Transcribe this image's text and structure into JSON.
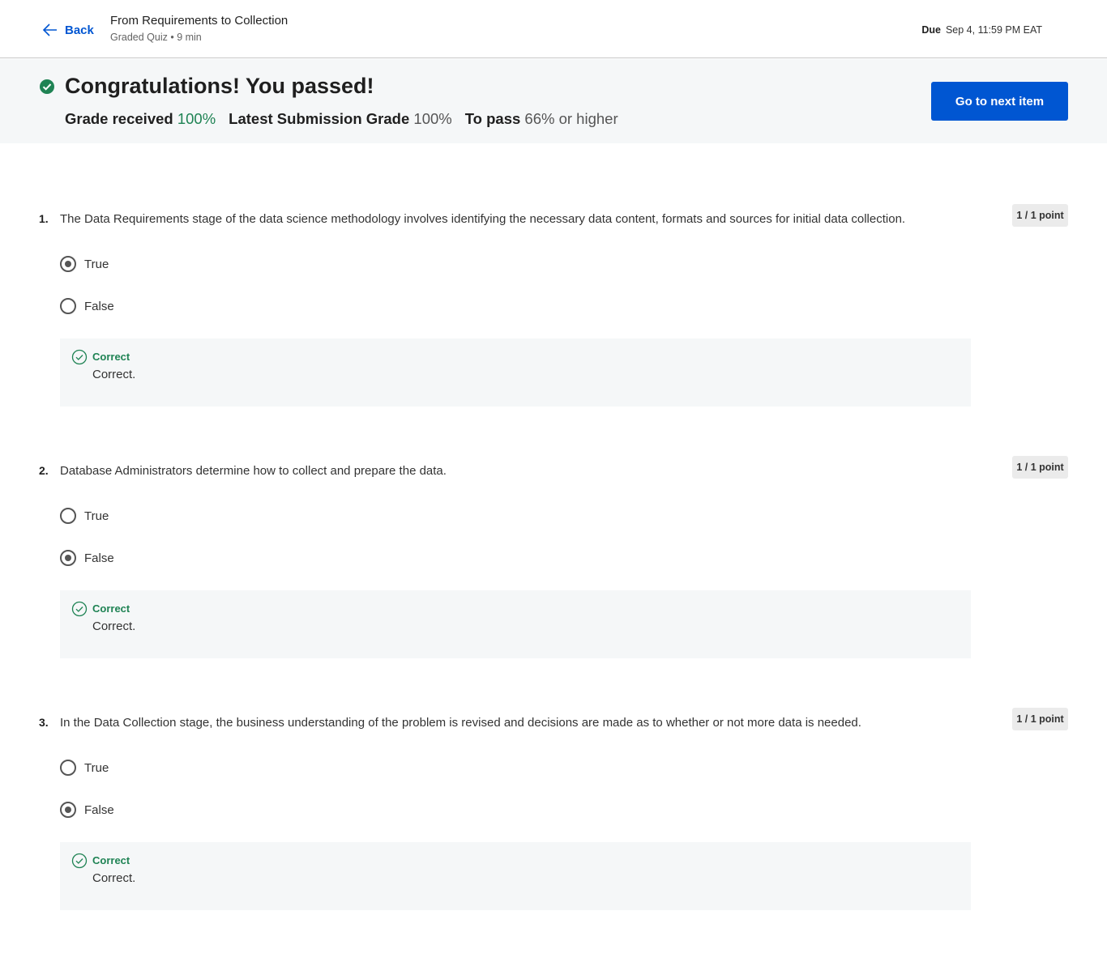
{
  "header": {
    "back_label": "Back",
    "title": "From Requirements to Collection",
    "subtitle": "Graded Quiz • 9 min",
    "due_label": "Due",
    "due_value": "Sep 4, 11:59 PM EAT"
  },
  "banner": {
    "heading": "Congratulations! You passed!",
    "grade_received_label": "Grade received",
    "grade_received_value": "100%",
    "latest_label": "Latest Submission Grade",
    "latest_value": "100%",
    "to_pass_label": "To pass",
    "to_pass_value": "66% or higher",
    "next_button": "Go to next item"
  },
  "questions": [
    {
      "number": "1.",
      "text": "The Data Requirements stage of the data science methodology involves identifying the necessary data content, formats and sources for initial data collection.",
      "points": "1 / 1 point",
      "options": [
        {
          "label": "True",
          "selected": true
        },
        {
          "label": "False",
          "selected": false
        }
      ],
      "feedback_label": "Correct",
      "feedback_text": "Correct."
    },
    {
      "number": "2.",
      "text": "Database Administrators determine how to collect and prepare the data.",
      "points": "1 / 1 point",
      "options": [
        {
          "label": "True",
          "selected": false
        },
        {
          "label": "False",
          "selected": true
        }
      ],
      "feedback_label": "Correct",
      "feedback_text": "Correct."
    },
    {
      "number": "3.",
      "text": "In the Data Collection stage, the business understanding of the problem is revised and decisions are made as to whether or not more data is needed.",
      "points": "1 / 1 point",
      "options": [
        {
          "label": "True",
          "selected": false
        },
        {
          "label": "False",
          "selected": true
        }
      ],
      "feedback_label": "Correct",
      "feedback_text": "Correct."
    }
  ],
  "colors": {
    "accent": "#0056d2",
    "success": "#1f8354",
    "banner_bg": "#f5f7f8"
  }
}
